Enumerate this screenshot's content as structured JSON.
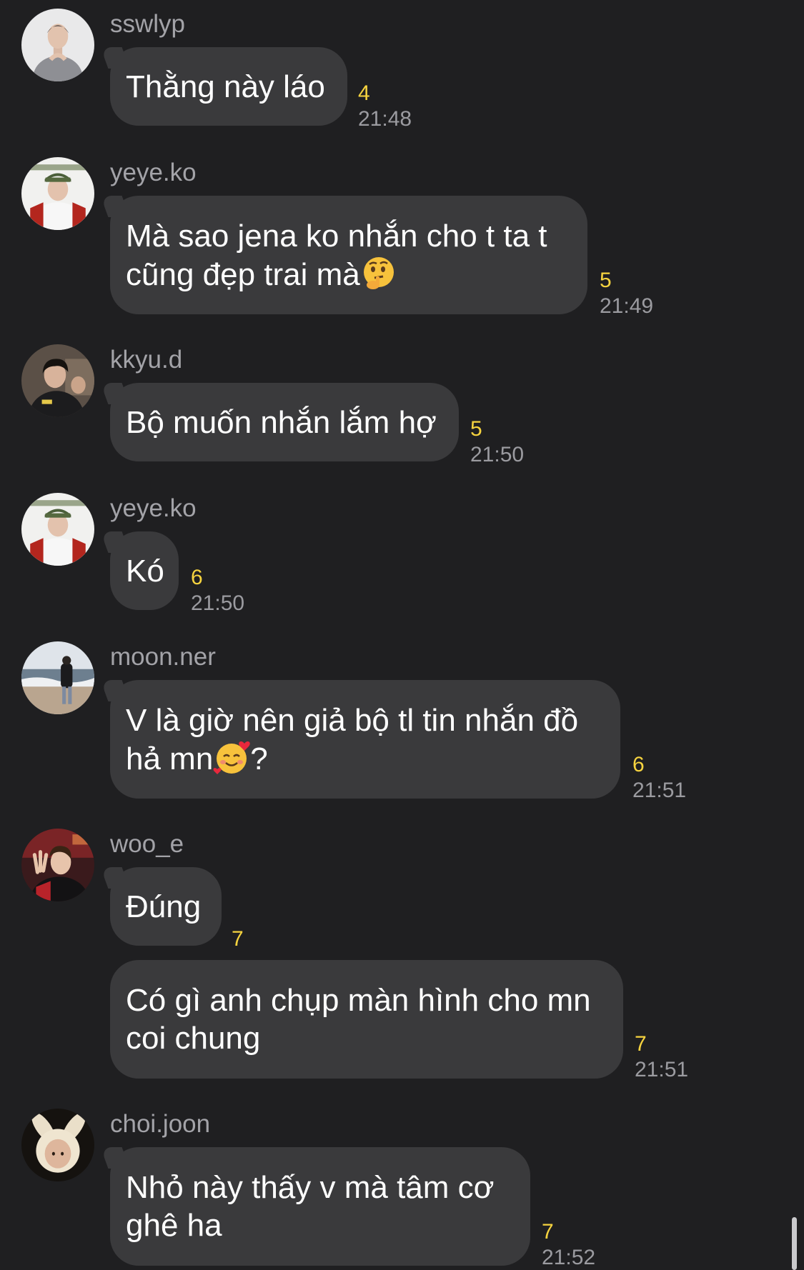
{
  "messages": [
    {
      "sender": "sswlyp",
      "lines": [
        "Thằng này láo"
      ],
      "unread": "4",
      "time": "21:48"
    },
    {
      "sender": "yeye.ko",
      "lines": [
        "Mà sao jena ko nhắn cho t ta t",
        "cũng đẹp trai mà"
      ],
      "emoji": "thinking-face-emoji",
      "unread": "5",
      "time": "21:49"
    },
    {
      "sender": "kkyu.d",
      "lines": [
        "Bộ muốn nhắn lắm hợ"
      ],
      "unread": "5",
      "time": "21:50"
    },
    {
      "sender": "yeye.ko",
      "lines": [
        "Kó"
      ],
      "unread": "6",
      "time": "21:50"
    },
    {
      "sender": "moon.ner",
      "lines": [
        "V là giờ nên giả bộ tl tin nhắn đồ",
        "hả mn",
        "?"
      ],
      "emoji": "smiling-face-with-hearts-emoji",
      "unread": "6",
      "time": "21:51"
    },
    {
      "sender": "woo_e",
      "lines": [
        "Đúng"
      ],
      "unread": "7"
    },
    {
      "lines": [
        "Có gì anh chụp màn hình cho mn",
        "coi chung"
      ],
      "unread": "7",
      "time": "21:51"
    },
    {
      "sender": "choi.joon",
      "lines": [
        "Nhỏ này thấy v mà tâm cơ",
        "ghê ha"
      ],
      "unread": "7",
      "time": "21:52"
    }
  ],
  "colors": {
    "background": "#1f1f21",
    "bubble": "#3a3a3c",
    "unread": "#f6d33f",
    "meta": "#9b9ba0"
  }
}
